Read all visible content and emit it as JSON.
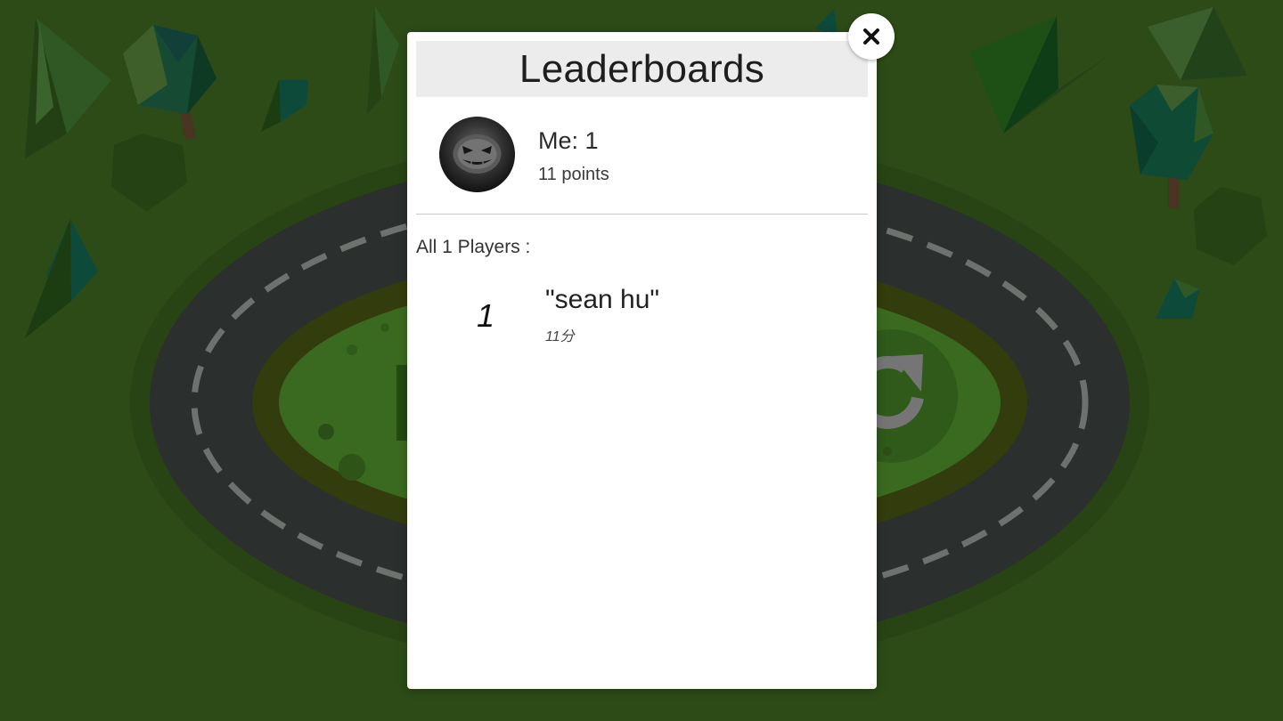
{
  "leaderboard": {
    "title": "Leaderboards",
    "me": {
      "rank_text": "Me: 1",
      "points_text": "11 points"
    },
    "players_label": "All 1 Players :",
    "players": [
      {
        "rank": "1",
        "name": "\"sean hu\"",
        "score": "11分"
      }
    ]
  },
  "icons": {
    "close": "close-icon",
    "avatar": "jack-o-lantern-avatar",
    "restart": "restart-icon"
  },
  "colors": {
    "background": "#2c4b17",
    "track": "#2b2f2d",
    "modal": "#ffffff",
    "header": "#ececec"
  }
}
